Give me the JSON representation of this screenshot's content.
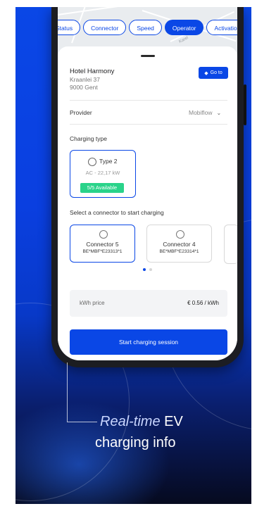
{
  "filters": [
    "Status",
    "Connector",
    "Speed",
    "Operator",
    "Activation"
  ],
  "active_filter": "Operator",
  "map_labels": {
    "street": "Karel"
  },
  "location": {
    "name": "Hotel Harmony",
    "street": "Kraanlei 37",
    "city": "9000 Gent",
    "goto_label": "Go to"
  },
  "provider": {
    "label": "Provider",
    "value": "Mobiflow"
  },
  "charging_type": {
    "heading": "Charging type",
    "name": "Type 2",
    "spec": "AC - 22,17 kW",
    "availability": "5/5 Available"
  },
  "connectors": {
    "heading": "Select a connector to start charging",
    "items": [
      {
        "name": "Connector 5",
        "id": "BE*MBF*E23313*1",
        "selected": true
      },
      {
        "name": "Connector 4",
        "id": "BE*MBF*E23314*1",
        "selected": false
      }
    ]
  },
  "pager": {
    "count": 2,
    "active": 0
  },
  "price": {
    "label": "kWh price",
    "value": "€ 0.56 / kWh"
  },
  "start_button": "Start charging session",
  "tagline": {
    "italic": "Real-time",
    "ev": "EV",
    "line2": "charging info"
  },
  "colors": {
    "brand": "#0a47e6",
    "available": "#2ad38a"
  }
}
